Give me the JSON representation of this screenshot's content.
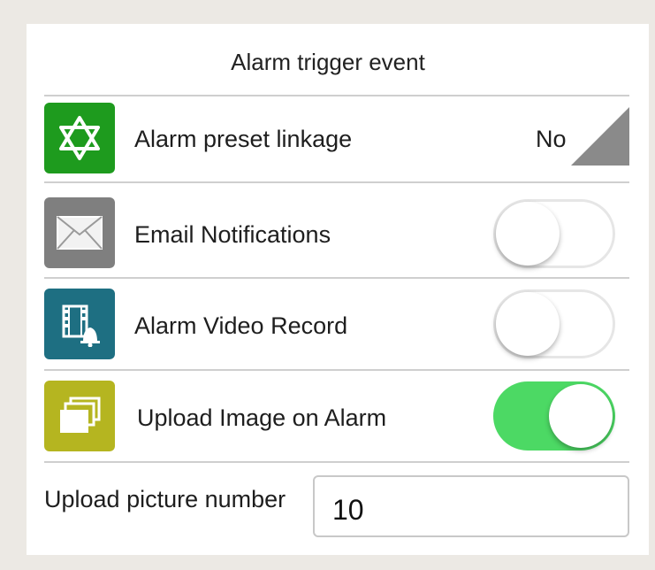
{
  "header": {
    "title": "Alarm trigger event"
  },
  "rows": [
    {
      "label": "Alarm preset linkage",
      "value": "No",
      "icon": "star-of-david-icon",
      "color": "#1e9b1e"
    },
    {
      "label": "Email Notifications",
      "toggle": "off",
      "icon": "envelope-icon",
      "color": "#7f7f7f"
    },
    {
      "label": "Alarm Video Record",
      "toggle": "off",
      "icon": "film-bell-icon",
      "color": "#1e6f82"
    },
    {
      "label": "Upload Image on Alarm",
      "toggle": "on",
      "icon": "stacked-images-icon",
      "color": "#b5b520"
    }
  ],
  "upload_picture": {
    "label": "Upload picture number",
    "value": "10"
  },
  "colors": {
    "toggle_on": "#4cd964",
    "background": "#ece9e4",
    "panel": "#ffffff"
  }
}
